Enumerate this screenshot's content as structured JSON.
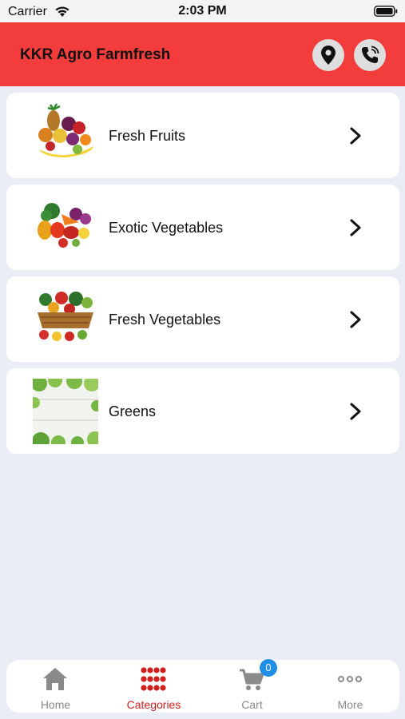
{
  "status_bar": {
    "carrier": "Carrier",
    "time": "2:03 PM"
  },
  "header": {
    "title": "KKR Agro Farmfresh",
    "background": "#f33c3c"
  },
  "categories": [
    {
      "label": "Fresh Fruits",
      "icon": "fruits-image"
    },
    {
      "label": "Exotic Vegetables",
      "icon": "exotic-vegetables-image"
    },
    {
      "label": "Fresh Vegetables",
      "icon": "vegetable-basket-image"
    },
    {
      "label": "Greens",
      "icon": "greens-image"
    }
  ],
  "bottom_nav": {
    "items": [
      {
        "label": "Home",
        "icon": "home-icon"
      },
      {
        "label": "Categories",
        "icon": "grid-dots-icon",
        "active": true
      },
      {
        "label": "Cart",
        "icon": "cart-icon"
      },
      {
        "label": "More",
        "icon": "more-dots-icon"
      }
    ],
    "cart_count": "0",
    "active_color": "#d11f1f",
    "badge_color": "#1e90e6"
  }
}
